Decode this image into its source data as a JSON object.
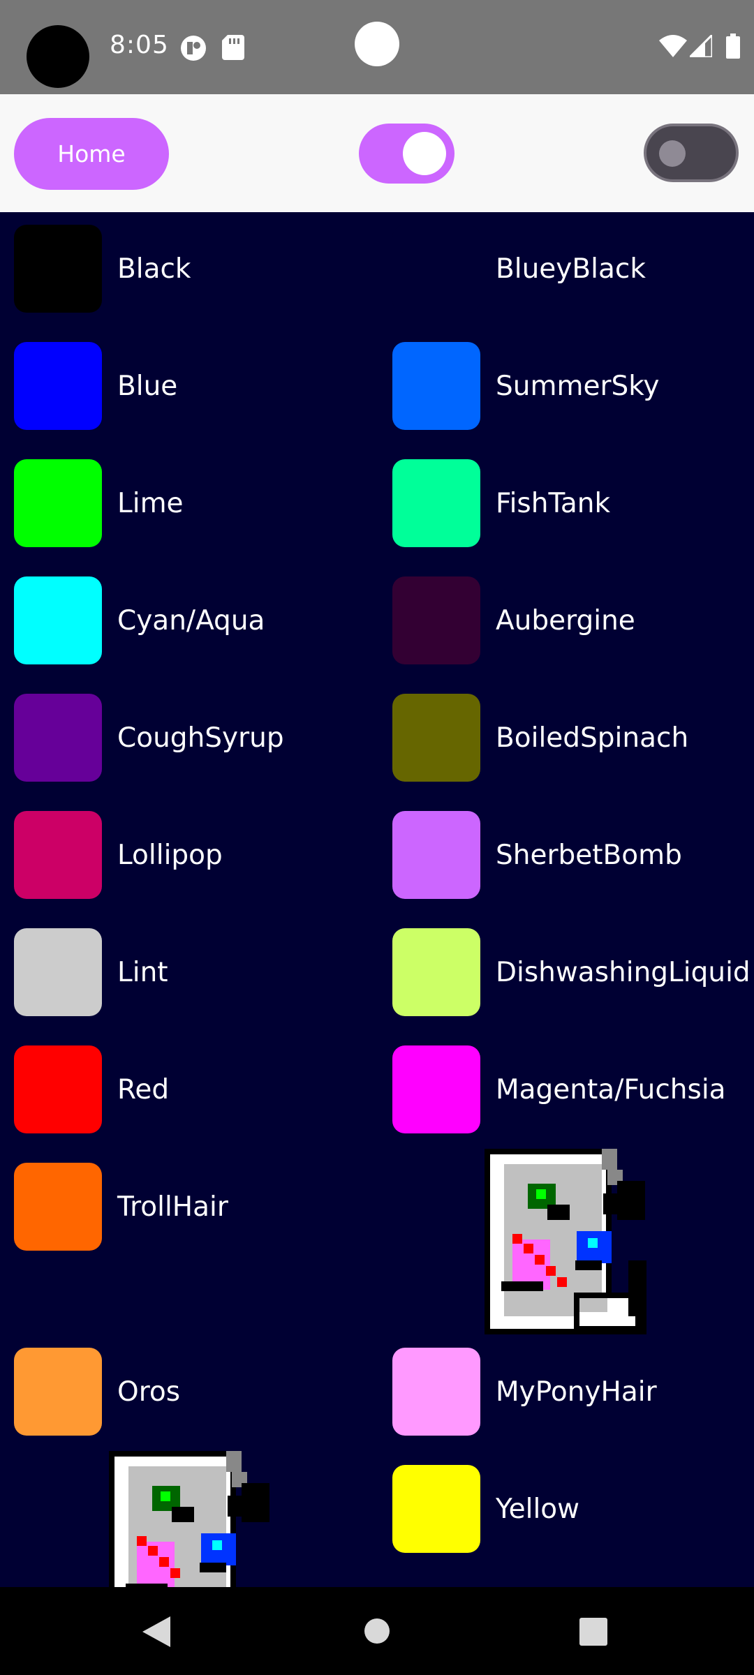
{
  "status_bar": {
    "time": "8:05",
    "icons": [
      "notification-icon",
      "sd-card-icon",
      "wifi-icon",
      "signal-icon",
      "battery-icon"
    ]
  },
  "toolbar": {
    "home_label": "Home",
    "toggle_left_on": true,
    "toggle_right_on": false,
    "accent": "#cc66ff"
  },
  "colors": {
    "left": [
      {
        "name": "Black",
        "hex": "#000000"
      },
      {
        "name": "Blue",
        "hex": "#0000ff"
      },
      {
        "name": "Lime",
        "hex": "#00ff00"
      },
      {
        "name": "Cyan/Aqua",
        "hex": "#00ffff"
      },
      {
        "name": "CoughSyrup",
        "hex": "#660099"
      },
      {
        "name": "Lollipop",
        "hex": "#cc0066"
      },
      {
        "name": "Lint",
        "hex": "#cccccc"
      },
      {
        "name": "Red",
        "hex": "#ff0000"
      },
      {
        "name": "TrollHair",
        "hex": "#ff6600"
      },
      {
        "name": "Oros",
        "hex": "#ff9933"
      }
    ],
    "right": [
      {
        "name": "BlueyBlack",
        "hex": "#000033"
      },
      {
        "name": "SummerSky",
        "hex": "#0066ff"
      },
      {
        "name": "FishTank",
        "hex": "#00ff99"
      },
      {
        "name": "Aubergine",
        "hex": "#330033"
      },
      {
        "name": "BoiledSpinach",
        "hex": "#666600"
      },
      {
        "name": "SherbetBomb",
        "hex": "#cc66ff"
      },
      {
        "name": "DishwashingLiquid",
        "hex": "#ccff66"
      },
      {
        "name": "Magenta/Fuchsia",
        "hex": "#ff00ff"
      },
      {
        "name": "MyPonyHair",
        "hex": "#ff99ff"
      },
      {
        "name": "Yellow",
        "hex": "#ffff00"
      }
    ]
  },
  "background": "#000033",
  "nav_bar": {
    "icons": [
      "back-icon",
      "home-icon",
      "recents-icon"
    ]
  }
}
